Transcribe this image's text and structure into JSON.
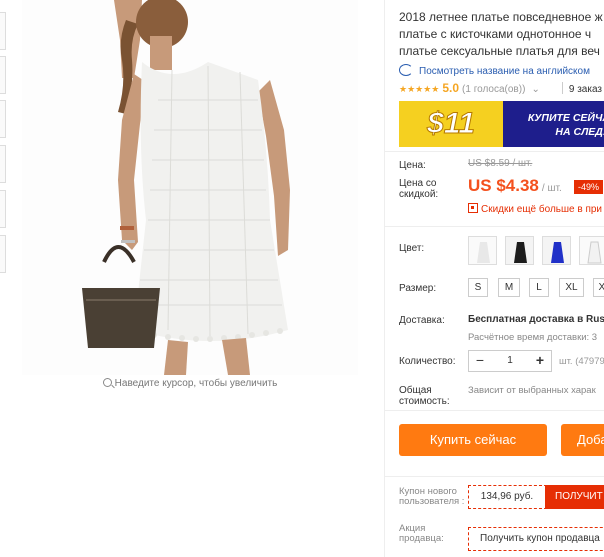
{
  "product": {
    "title_lines": [
      "2018 летнее платье повседневное ж",
      "платье с кисточками однотонное ч",
      "платье сексуальные платья для веч"
    ],
    "zoom_hint": "Наведите курсор, чтобы увеличить",
    "translate_link": "Посмотреть название на английском",
    "rating": {
      "stars": "★★★★★",
      "score": "5.0",
      "votes": "(1 голоса(ов))",
      "chevron": "⌄",
      "orders": "9 заказ"
    }
  },
  "promo": {
    "amount": "$11",
    "line1": "КУПИТЕ СЕЙЧА",
    "line2": "НА СЛЕДУ"
  },
  "price": {
    "label_price": "Цена:",
    "old": "US $8.59 / шт.",
    "label_discount": "Цена со скидкой:",
    "current": "US $4.38",
    "unit": "/ шт.",
    "discount_badge": "-49%",
    "coupon_link": "Скидки ещё больше в при"
  },
  "options": {
    "color_label": "Цвет:",
    "colors": [
      {
        "name": "white",
        "hex": "#e8e8e8"
      },
      {
        "name": "black",
        "hex": "#1c1c1c"
      },
      {
        "name": "blue",
        "hex": "#2030c8"
      },
      {
        "name": "white-lace",
        "hex": "#f2f2f2"
      }
    ],
    "size_label": "Размер:",
    "sizes": [
      "S",
      "M",
      "L",
      "XL",
      "XXL"
    ]
  },
  "shipping": {
    "label": "Доставка:",
    "method": "Бесплатная доставка в Rus",
    "estimate": "Расчётное время доставки: 3"
  },
  "quantity": {
    "label": "Количество:",
    "minus": "−",
    "value": "1",
    "plus": "+",
    "note": "шт. (47979"
  },
  "total": {
    "label": "Общая стоимость:",
    "note": "Зависит от выбранных харак"
  },
  "actions": {
    "buy_now": "Купить сейчас",
    "add_to_cart": "Доба"
  },
  "coupons": {
    "new_user_label": "Купон нового пользователя :",
    "new_user_value": "134,96 руб.",
    "new_user_button": "ПОЛУЧИТ",
    "seller_label": "Акция продавца:",
    "seller_button": "Получить купон продавца"
  },
  "colors": {
    "accent": "#ff7a11",
    "price": "#f4511e",
    "sale": "#e62e04",
    "link": "#2a5db0"
  }
}
